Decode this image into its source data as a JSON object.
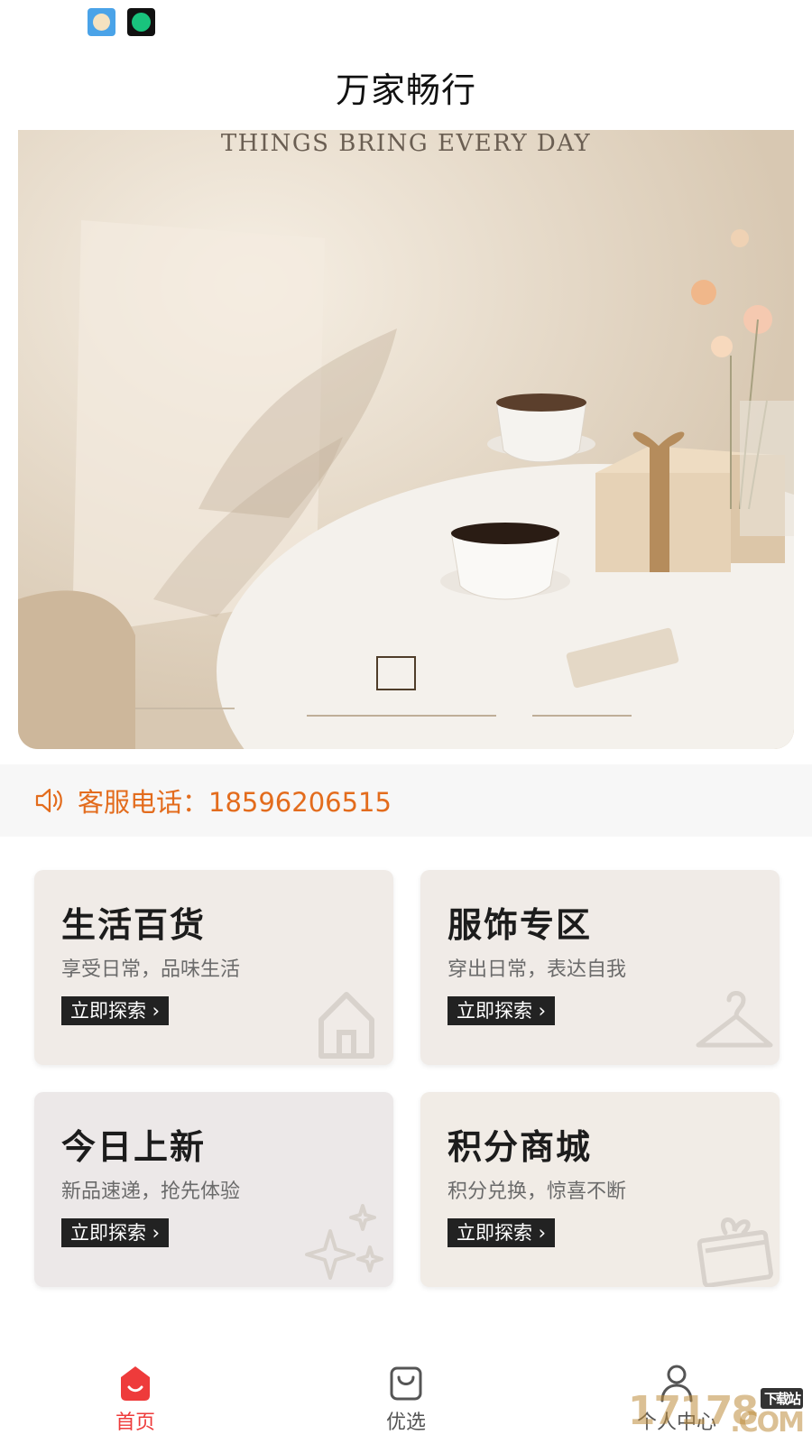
{
  "status_bar": {
    "apps": [
      "app-icon-1",
      "app-icon-2"
    ]
  },
  "header": {
    "title": "万家畅行"
  },
  "banner": {
    "headline": "THINGS BRING EVERY DAY"
  },
  "notice": {
    "icon": "speaker-icon",
    "text": "客服电话：18596206515",
    "color": "#e36c1d"
  },
  "cards": [
    {
      "title": "生活百货",
      "subtitle": "享受日常，品味生活",
      "button": "立即探索 ›",
      "icon": "house-icon"
    },
    {
      "title": "服饰专区",
      "subtitle": "穿出日常，表达自我",
      "button": "立即探索 ›",
      "icon": "hanger-icon"
    },
    {
      "title": "今日上新",
      "subtitle": "新品速递，抢先体验",
      "button": "立即探索 ›",
      "icon": "sparkle-icon"
    },
    {
      "title": "积分商城",
      "subtitle": "积分兑换，惊喜不断",
      "button": "立即探索 ›",
      "icon": "gift-icon"
    }
  ],
  "tab_bar": {
    "items": [
      {
        "label": "首页",
        "icon": "home-icon",
        "active": true
      },
      {
        "label": "优选",
        "icon": "shopping-bag-icon",
        "active": false
      },
      {
        "label": "个人中心",
        "icon": "user-icon",
        "active": false
      }
    ],
    "active_color": "#ee3b3b"
  },
  "watermark": {
    "text": "17178",
    "tag": "下载站",
    "suffix": ".COM"
  }
}
